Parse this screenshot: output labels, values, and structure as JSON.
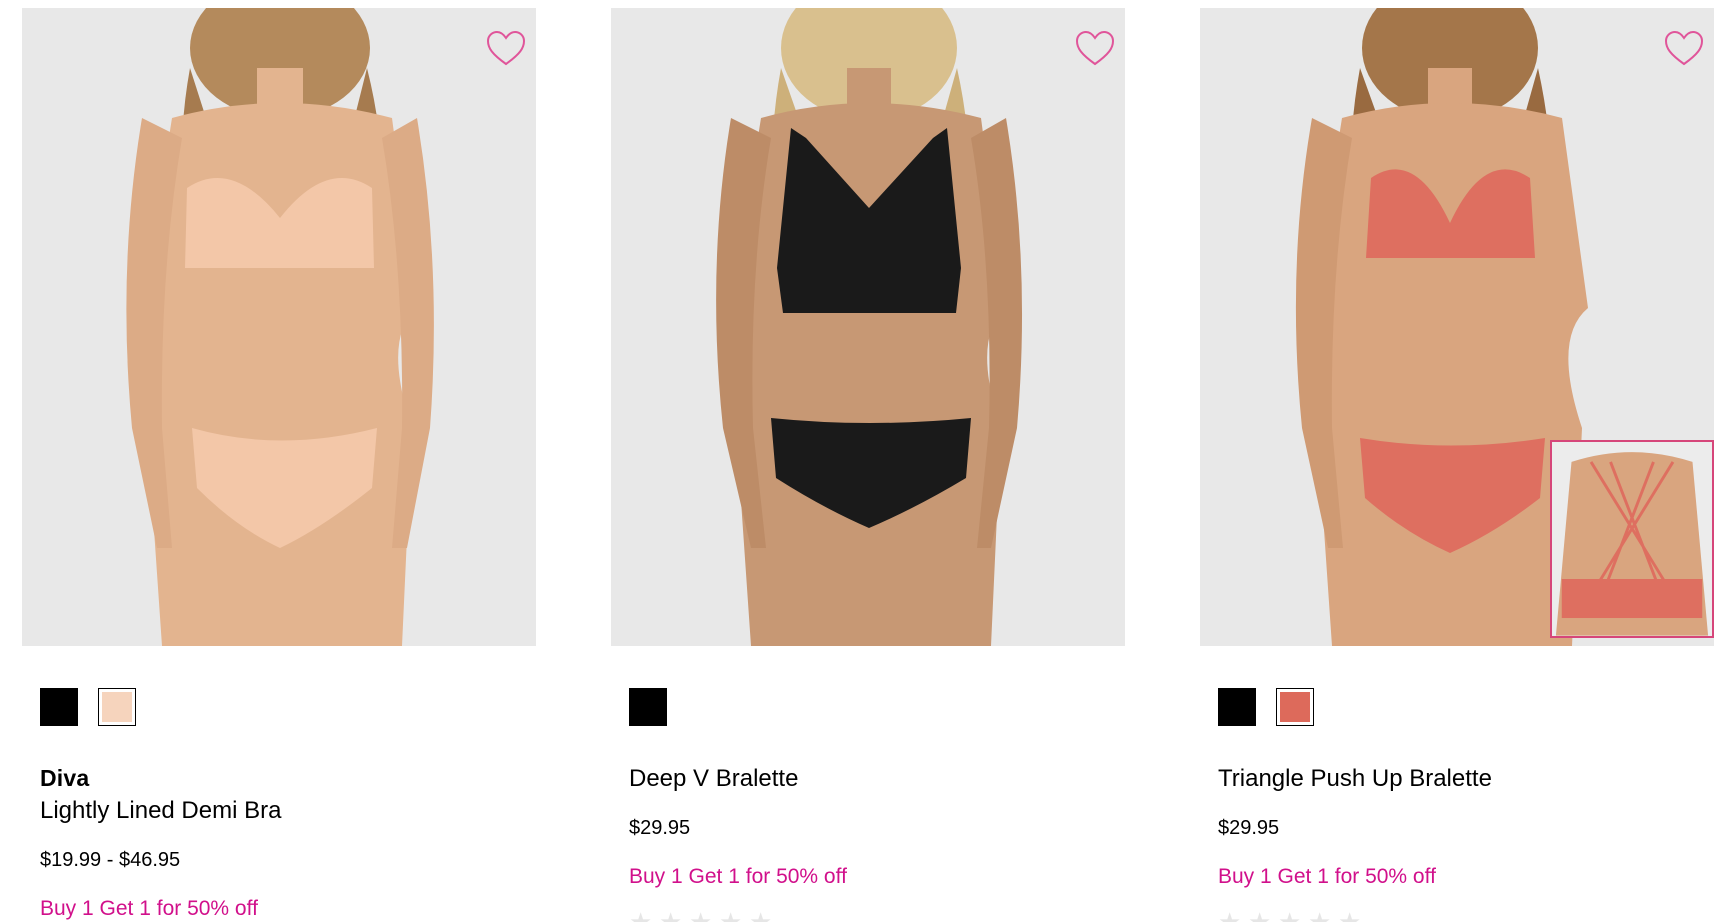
{
  "products": [
    {
      "brand": "Diva",
      "name": "Lightly Lined Demi Bra",
      "price": "$19.99 - $46.95",
      "promo": "Buy 1 Get 1 for 50% off",
      "swatches": [
        {
          "color": "#000000",
          "selected": false
        },
        {
          "color": "#f6d4bd",
          "selected": true
        }
      ],
      "garment_color": "#f3c7a8",
      "favorite_icon": "heart-outline-icon"
    },
    {
      "brand": "",
      "name": "Deep V Bralette",
      "price": "$29.95",
      "promo": "Buy 1 Get 1 for 50% off",
      "swatches": [
        {
          "color": "#000000",
          "selected": false
        }
      ],
      "garment_color": "#1a1a1a",
      "favorite_icon": "heart-outline-icon"
    },
    {
      "brand": "",
      "name": "Triangle Push Up Bralette",
      "price": "$29.95",
      "promo": "Buy 1 Get 1 for 50% off",
      "swatches": [
        {
          "color": "#000000",
          "selected": false
        },
        {
          "color": "#dd6a5b",
          "selected": true
        }
      ],
      "garment_color": "#de6f60",
      "favorite_icon": "heart-outline-icon"
    }
  ],
  "colors": {
    "accent": "#d1108b",
    "heart": "#e0559a",
    "photo_bg": "#e8e8e8",
    "skin": "#e3b48f"
  }
}
